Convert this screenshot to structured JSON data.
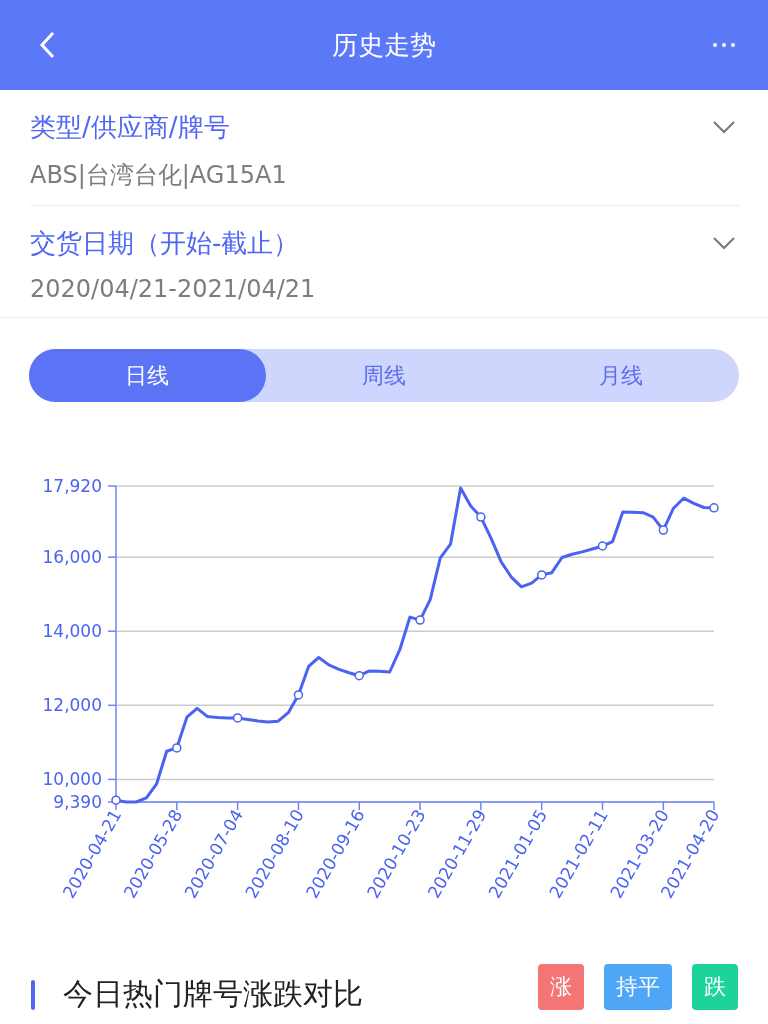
{
  "header": {
    "title": "历史走势"
  },
  "filters": [
    {
      "label": "类型/供应商/牌号",
      "value": "ABS|台湾台化|AG15A1",
      "expanded": false
    },
    {
      "label": "交货日期（开始-截止）",
      "value": "2020/04/21-2021/04/21",
      "expanded": false
    }
  ],
  "tabs": [
    {
      "label": "日线",
      "selected": true
    },
    {
      "label": "周线",
      "selected": false
    },
    {
      "label": "月线",
      "selected": false
    }
  ],
  "chart": {
    "chart_data": {
      "type": "line",
      "categories": [
        "2020-04-21",
        null,
        null,
        null,
        null,
        null,
        "2020-05-28",
        null,
        null,
        null,
        null,
        null,
        "2020-07-04",
        null,
        null,
        null,
        null,
        null,
        "2020-08-10",
        null,
        null,
        null,
        null,
        null,
        "2020-09-16",
        null,
        null,
        null,
        null,
        null,
        "2020-10-23",
        null,
        null,
        null,
        null,
        null,
        "2020-11-29",
        null,
        null,
        null,
        null,
        null,
        "2021-01-05",
        null,
        null,
        null,
        null,
        null,
        "2021-02-11",
        null,
        null,
        null,
        null,
        null,
        "2021-03-20",
        null,
        null,
        null,
        null,
        "2021-04-20"
      ],
      "series": [
        {
          "color": "#4a63f0",
          "values": [
            9440,
            9390,
            9390,
            9500,
            9870,
            10760,
            10850,
            11680,
            11920,
            11700,
            11670,
            11660,
            11660,
            11620,
            11580,
            11550,
            11570,
            11800,
            12280,
            13050,
            13290,
            13090,
            12970,
            12880,
            12800,
            12930,
            12920,
            12900,
            13500,
            14380,
            14300,
            14850,
            15980,
            16350,
            17870,
            17380,
            17080,
            16510,
            15870,
            15460,
            15200,
            15300,
            15520,
            15580,
            15990,
            16080,
            16140,
            16220,
            16300,
            16420,
            17220,
            17210,
            17200,
            17080,
            16730,
            17320,
            17590,
            17450,
            17340,
            17330
          ]
        }
      ],
      "ylim": [
        9390,
        17920
      ],
      "grid": true,
      "yticks": [
        {
          "value": 9390,
          "label": "9,390"
        },
        {
          "value": 10000,
          "label": "10,000"
        },
        {
          "value": 12000,
          "label": "12,000"
        },
        {
          "value": 14000,
          "label": "14,000"
        },
        {
          "value": 16000,
          "label": "16,000"
        },
        {
          "value": 17920,
          "label": "17,920"
        }
      ]
    }
  },
  "comparison": {
    "title": "今日热门牌号涨跌对比",
    "legend": [
      {
        "label": "涨",
        "color": "#f47575"
      },
      {
        "label": "持平",
        "color": "#4fa6f7"
      },
      {
        "label": "跌",
        "color": "#1ed39b"
      }
    ]
  }
}
